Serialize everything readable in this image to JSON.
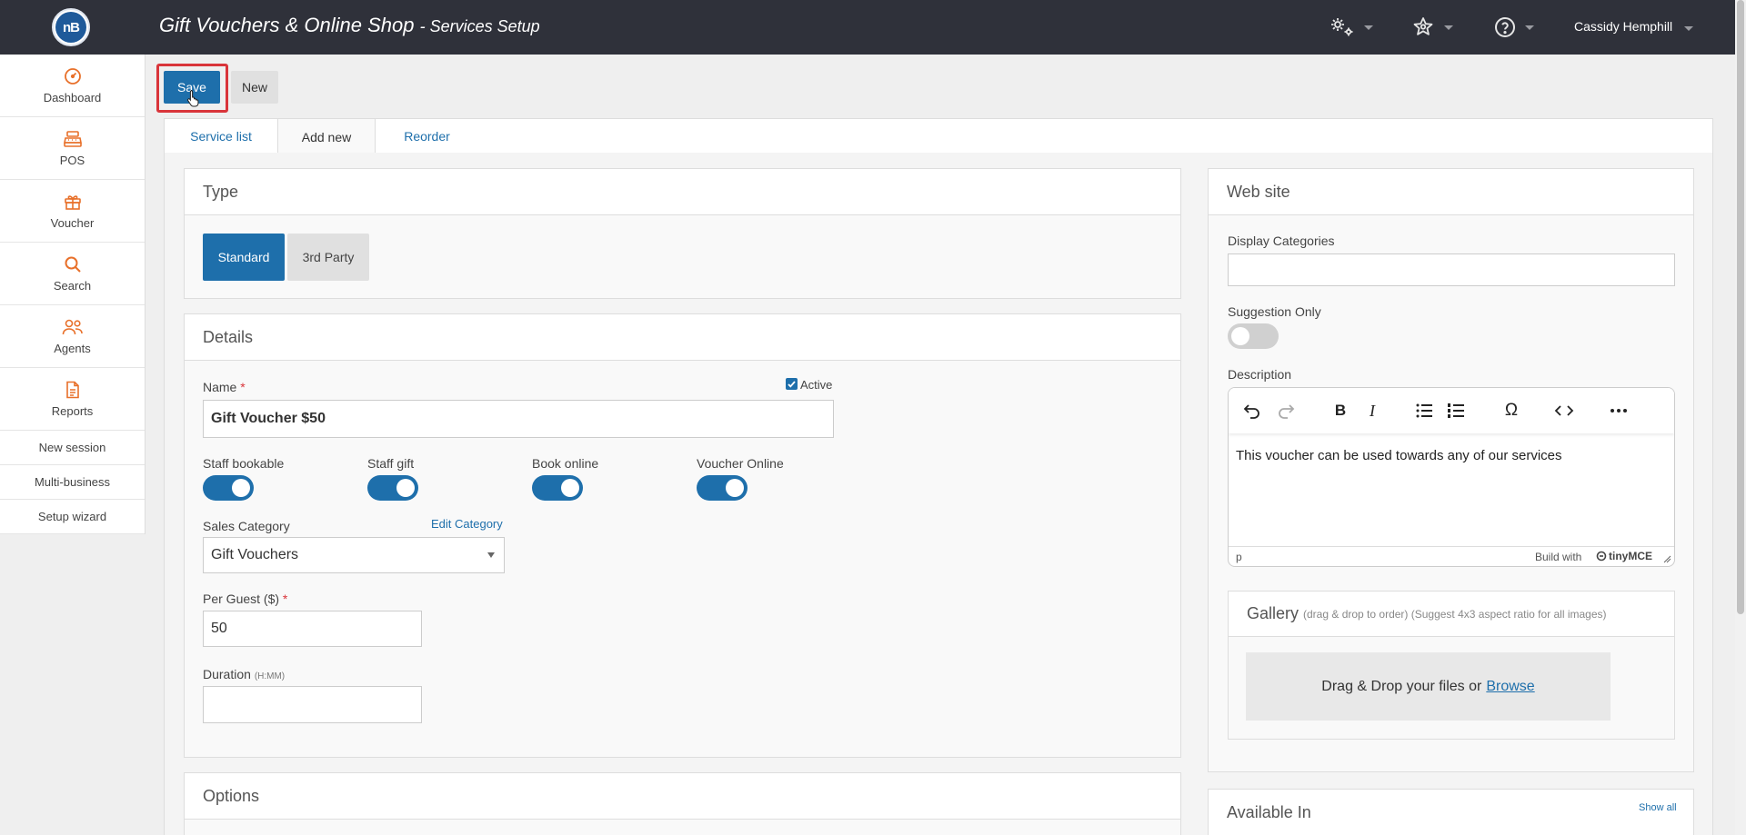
{
  "app": {
    "logo_text": "nB",
    "title": "Gift Vouchers & Online Shop",
    "subtitle": "- Services Setup"
  },
  "topbar": {
    "icons": [
      "settings-gears-icon",
      "star-tools-icon",
      "help-icon"
    ],
    "user_name": "Cassidy Hemphill"
  },
  "sidebar": {
    "items": [
      {
        "label": "Dashboard",
        "icon": "dashboard-icon"
      },
      {
        "label": "POS",
        "icon": "cash-register-icon"
      },
      {
        "label": "Voucher",
        "icon": "gift-icon"
      },
      {
        "label": "Search",
        "icon": "search-icon"
      },
      {
        "label": "Agents",
        "icon": "agents-icon"
      },
      {
        "label": "Reports",
        "icon": "report-icon"
      }
    ],
    "links": [
      "New session",
      "Multi-business",
      "Setup wizard"
    ]
  },
  "toolbar": {
    "save_label": "Save",
    "new_label": "New"
  },
  "tabs": [
    "Service list",
    "Add new",
    "Reorder"
  ],
  "active_tab": "Add new",
  "type_panel": {
    "title": "Type",
    "options": [
      "Standard",
      "3rd Party"
    ],
    "selected": "Standard"
  },
  "details": {
    "title": "Details",
    "name_label": "Name",
    "required_mark": "*",
    "name_value": "Gift Voucher $50",
    "active_label": "Active",
    "active_checked": true,
    "toggles": [
      {
        "label": "Staff bookable",
        "on": true
      },
      {
        "label": "Staff gift",
        "on": true
      },
      {
        "label": "Book online",
        "on": true
      },
      {
        "label": "Voucher Online",
        "on": true
      }
    ],
    "sales_category_label": "Sales Category",
    "edit_category_link": "Edit Category",
    "sales_category_value": "Gift Vouchers",
    "per_guest_label": "Per Guest ($)",
    "per_guest_value": "50",
    "duration_label": "Duration",
    "duration_note": "(H:MM)",
    "duration_value": ""
  },
  "options_panel": {
    "title": "Options"
  },
  "website": {
    "title": "Web site",
    "display_categories_label": "Display Categories",
    "display_categories_value": "",
    "suggestion_only_label": "Suggestion Only",
    "suggestion_only_on": false,
    "description_label": "Description",
    "description_text": "This voucher can be used towards any of our services",
    "editor_status_path": "p",
    "editor_brand_prefix": "Build with",
    "editor_brand": "tinyMCE",
    "editor_tools": [
      "undo-icon",
      "redo-icon",
      "bold-icon",
      "italic-icon",
      "bullet-list-icon",
      "numbered-list-icon",
      "omega-icon",
      "code-icon",
      "more-icon"
    ]
  },
  "gallery": {
    "title": "Gallery",
    "hint": "(drag & drop to order) (Suggest 4x3 aspect ratio for all images)",
    "drop_text": "Drag & Drop your files or",
    "browse_link": "Browse"
  },
  "available_in": {
    "title": "Available In",
    "show_all_link": "Show all"
  },
  "colors": {
    "topbar": "#2f313a",
    "accent": "#1e6fab",
    "sidebar_icon": "#e8702a",
    "highlight": "#d9343a"
  }
}
